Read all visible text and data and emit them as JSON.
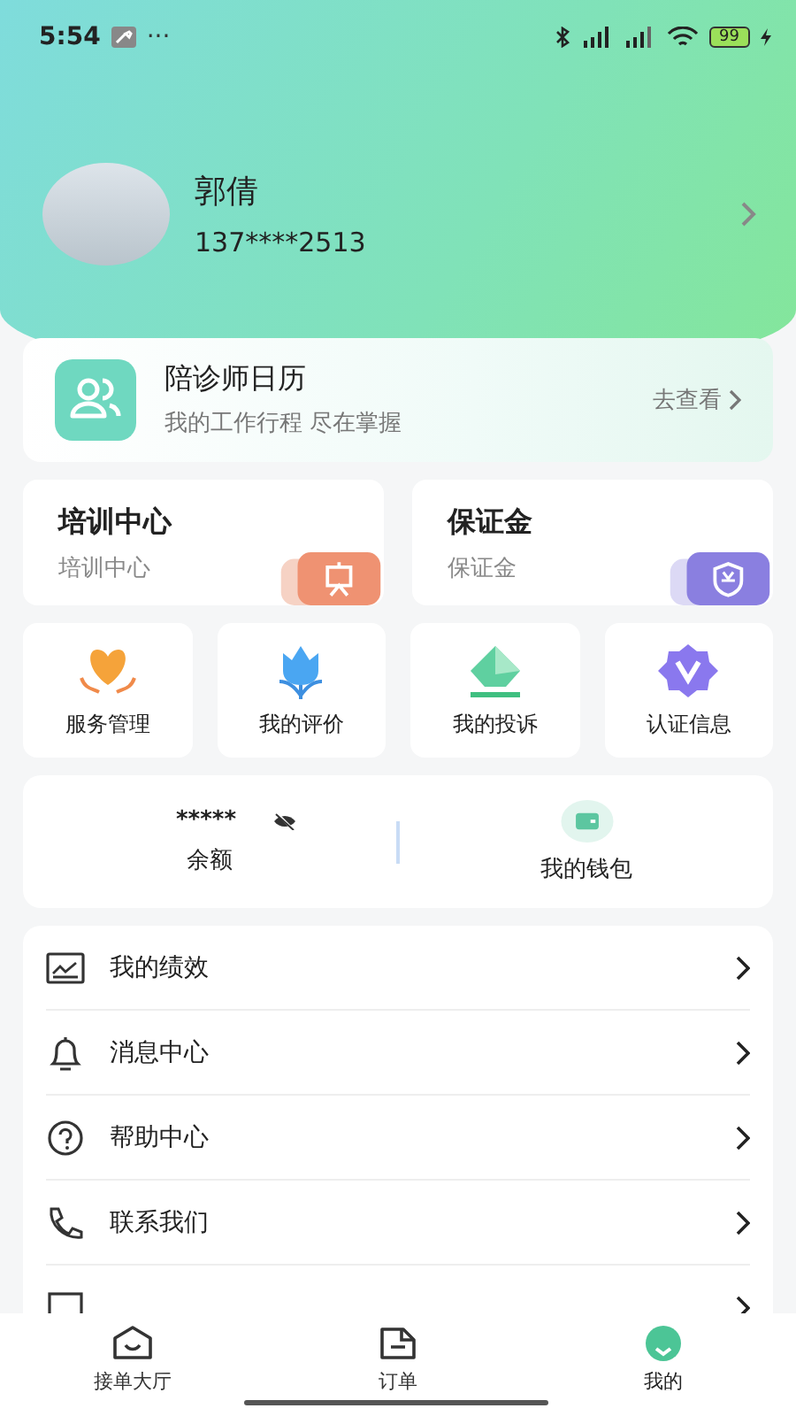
{
  "status_bar": {
    "time": "5:54",
    "dots": "···",
    "battery": "99"
  },
  "profile": {
    "name": "郭倩",
    "phone": "137****2513"
  },
  "calendar_card": {
    "title": "陪诊师日历",
    "subtitle": "我的工作行程 尽在掌握",
    "action": "去查看"
  },
  "feature_cards": [
    {
      "kind": "training",
      "title": "培训中心",
      "subtitle": "培训中心"
    },
    {
      "kind": "deposit",
      "title": "保证金",
      "subtitle": "保证金"
    }
  ],
  "shortcuts": [
    {
      "kind": "heart",
      "label": "服务管理"
    },
    {
      "kind": "flower",
      "label": "我的评价"
    },
    {
      "kind": "envelope",
      "label": "我的投诉"
    },
    {
      "kind": "badge",
      "label": "认证信息"
    }
  ],
  "wallet": {
    "balance": "*****",
    "balance_label": "余额",
    "wallet_label": "我的钱包"
  },
  "menu": [
    {
      "kind": "chart",
      "label": "我的绩效"
    },
    {
      "kind": "bell",
      "label": "消息中心"
    },
    {
      "kind": "help",
      "label": "帮助中心"
    },
    {
      "kind": "phone",
      "label": "联系我们"
    },
    {
      "kind": "feedback"
    }
  ],
  "tabs": [
    {
      "kind": "hall",
      "label": "接单大厅",
      "selected": false
    },
    {
      "kind": "orders",
      "label": "订单",
      "selected": false
    },
    {
      "kind": "me",
      "label": "我的",
      "selected": true
    }
  ]
}
